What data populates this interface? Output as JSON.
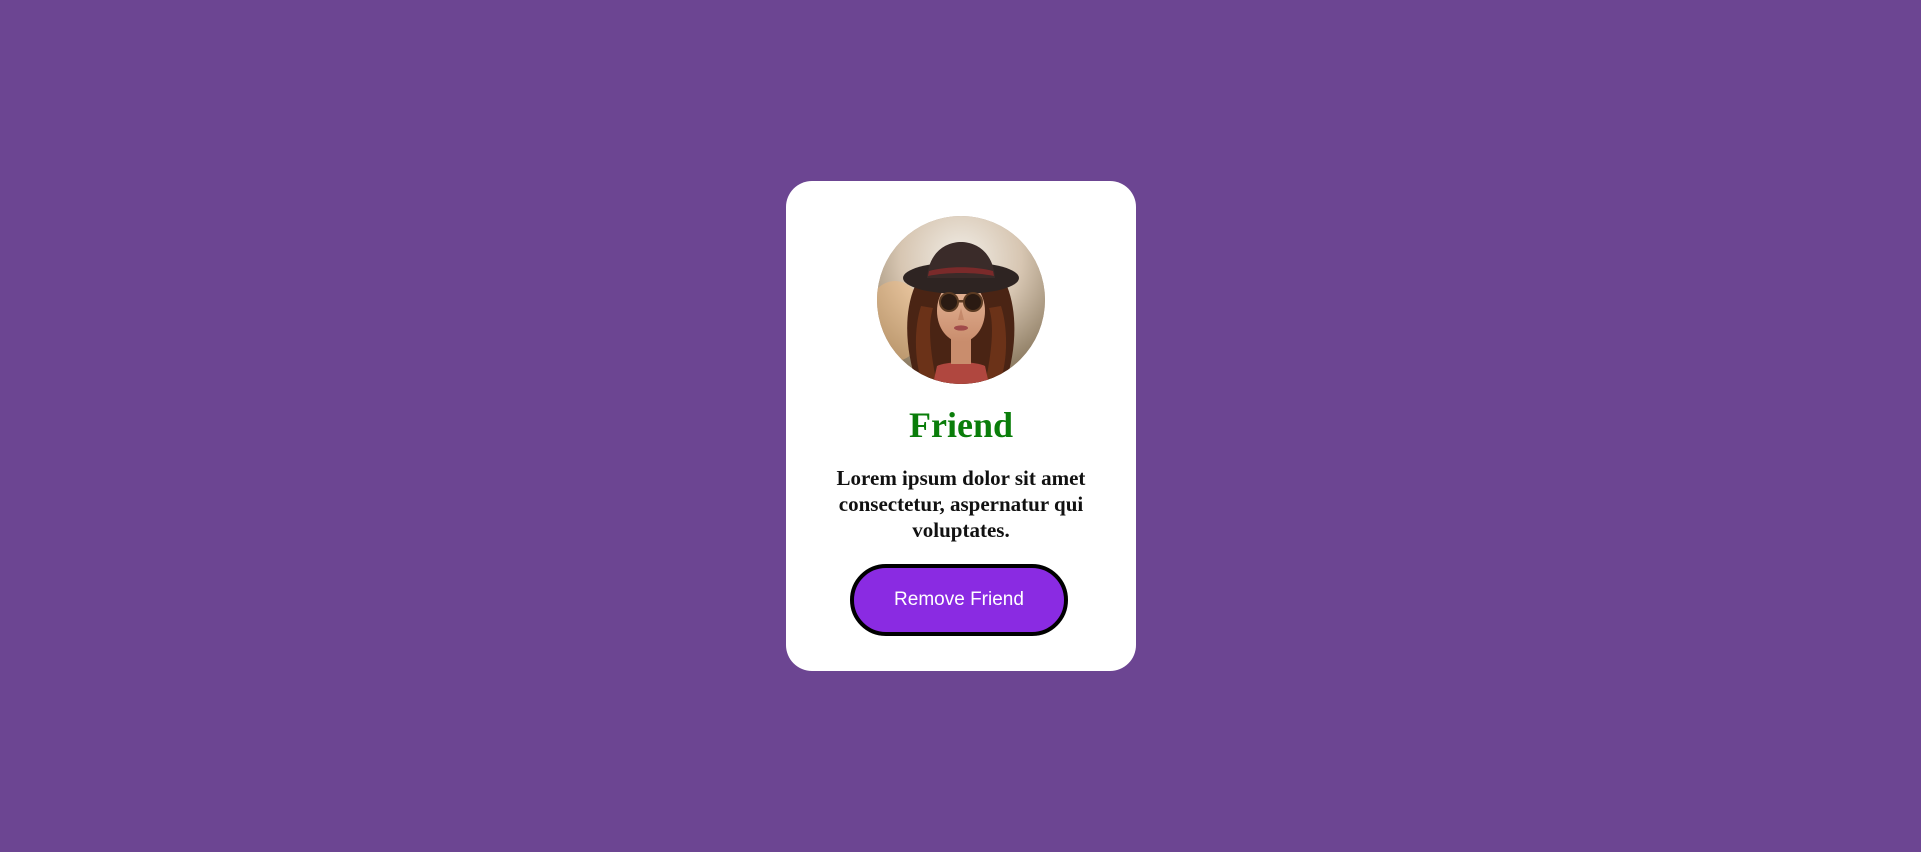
{
  "card": {
    "avatar_icon": "woman-with-hat-and-sunglasses-photo",
    "title": "Friend",
    "description": "Lorem ipsum dolor sit amet consectetur, aspernatur qui voluptates.",
    "button_label": "Remove Friend"
  },
  "colors": {
    "background": "#6c4592",
    "card": "#ffffff",
    "title": "#0a7d0a",
    "button": "#8a2be2",
    "button_border": "#000000",
    "button_text": "#ffffff"
  }
}
